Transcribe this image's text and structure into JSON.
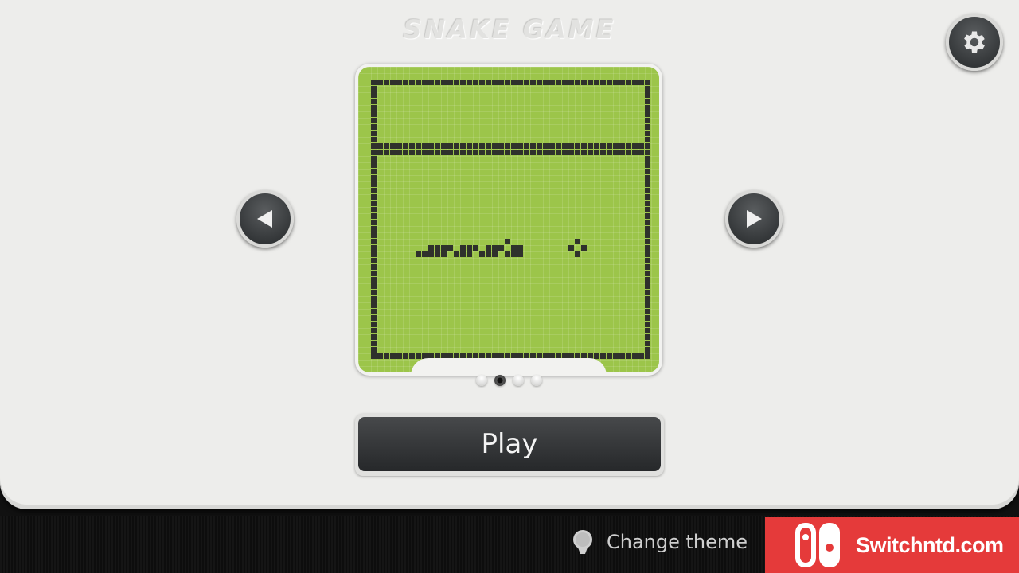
{
  "title": "SNAKE GAME",
  "settings": {
    "icon": "gear-icon"
  },
  "nav": {
    "prev_icon": "triangle-left-icon",
    "next_icon": "triangle-right-icon"
  },
  "preview": {
    "colors": {
      "lcd": "#9cc54a",
      "pixel": "#2f312c"
    },
    "grid_cols": 44,
    "grid_rows": 44,
    "divider_rows": [
      10,
      11
    ],
    "snake_cells": [
      [
        7,
        27
      ],
      [
        8,
        27
      ],
      [
        9,
        27
      ],
      [
        10,
        27
      ],
      [
        11,
        27
      ],
      [
        9,
        26
      ],
      [
        10,
        26
      ],
      [
        11,
        26
      ],
      [
        12,
        26
      ],
      [
        13,
        27
      ],
      [
        14,
        27
      ],
      [
        15,
        27
      ],
      [
        14,
        26
      ],
      [
        15,
        26
      ],
      [
        16,
        26
      ],
      [
        17,
        27
      ],
      [
        18,
        27
      ],
      [
        19,
        27
      ],
      [
        18,
        26
      ],
      [
        19,
        26
      ],
      [
        20,
        26
      ],
      [
        21,
        25
      ],
      [
        21,
        27
      ],
      [
        22,
        27
      ],
      [
        23,
        27
      ],
      [
        22,
        26
      ],
      [
        23,
        26
      ]
    ],
    "food_cells": [
      [
        32,
        25
      ],
      [
        31,
        26
      ],
      [
        33,
        26
      ],
      [
        32,
        27
      ]
    ]
  },
  "pager": {
    "count": 4,
    "active_index": 1
  },
  "play_label": "Play",
  "footer": {
    "change_theme_label": "Change theme",
    "change_theme_icon": "lightbulb-icon"
  },
  "watermark": {
    "text": "Switchntd.com",
    "color": "#e53a3a"
  }
}
